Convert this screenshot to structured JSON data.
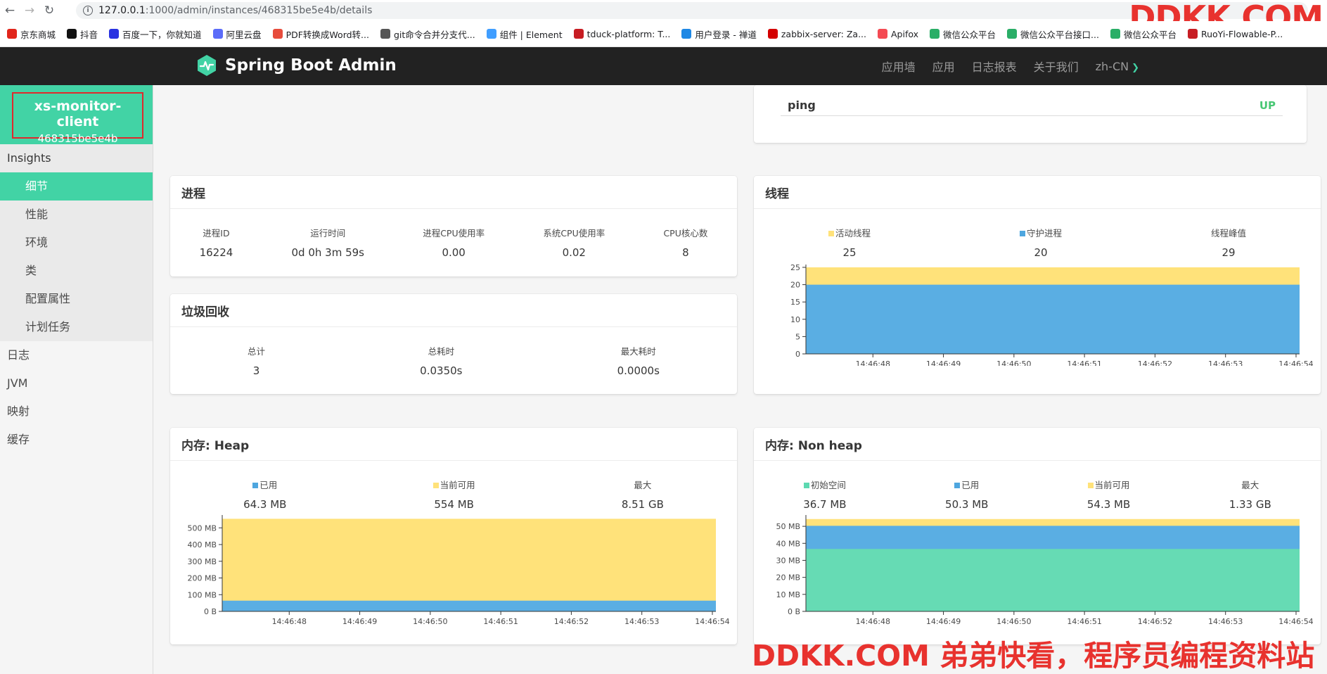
{
  "browser": {
    "url_host": "127.0.0.1",
    "url_path": ":1000/admin/instances/468315be5e4b/details",
    "bookmarks": [
      {
        "label": "京东商城",
        "icon": "jd-icon",
        "color": "#e1251b"
      },
      {
        "label": "抖音",
        "icon": "tiktok-icon",
        "color": "#111111"
      },
      {
        "label": "百度一下，你就知道",
        "icon": "baidu-icon",
        "color": "#2932e1"
      },
      {
        "label": "阿里云盘",
        "icon": "aliyun-drive-icon",
        "color": "#5b6cf9"
      },
      {
        "label": "PDF转换成Word转...",
        "icon": "pdf-icon",
        "color": "#e74c3c"
      },
      {
        "label": "git命令合并分支代...",
        "icon": "git-icon",
        "color": "#555555"
      },
      {
        "label": "组件 | Element",
        "icon": "element-icon",
        "color": "#409eff"
      },
      {
        "label": "tduck-platform: T...",
        "icon": "gitee-icon",
        "color": "#c71d23"
      },
      {
        "label": "用户登录 - 禅道",
        "icon": "zentao-icon",
        "color": "#1e88e5"
      },
      {
        "label": "zabbix-server: Za...",
        "icon": "zabbix-icon",
        "color": "#d40000"
      },
      {
        "label": "Apifox",
        "icon": "apifox-icon",
        "color": "#f44a53"
      },
      {
        "label": "微信公众平台",
        "icon": "wechat-icon",
        "color": "#2aae67"
      },
      {
        "label": "微信公众平台接口...",
        "icon": "wechat-icon",
        "color": "#2aae67"
      },
      {
        "label": "微信公众平台",
        "icon": "wechat-icon",
        "color": "#2aae67"
      },
      {
        "label": "RuoYi-Flowable-P...",
        "icon": "gitee-icon",
        "color": "#c71d23"
      }
    ]
  },
  "watermark": {
    "top": "DDKK.COM",
    "bottom": "DDKK.COM 弟弟快看，程序员编程资料站"
  },
  "app": {
    "brand": "Spring Boot Admin",
    "nav": [
      "应用墙",
      "应用",
      "日志报表",
      "关于我们",
      "zh-CN"
    ],
    "accent": "#42d3a5"
  },
  "sidebar": {
    "app_name": "xs-monitor-client",
    "instance_id": "468315be5e4b",
    "section": "Insights",
    "items": [
      "细节",
      "性能",
      "环境",
      "类",
      "配置属性",
      "计划任务"
    ],
    "active_item": "细节",
    "top_items": [
      "日志",
      "JVM",
      "映射",
      "缓存"
    ]
  },
  "health": {
    "name": "ping",
    "status": "UP"
  },
  "process": {
    "title": "进程",
    "stats": [
      {
        "label": "进程ID",
        "value": "16224"
      },
      {
        "label": "运行时间",
        "value": "0d 0h 3m 59s"
      },
      {
        "label": "进程CPU使用率",
        "value": "0.00"
      },
      {
        "label": "系统CPU使用率",
        "value": "0.02"
      },
      {
        "label": "CPU核心数",
        "value": "8"
      }
    ]
  },
  "gc": {
    "title": "垃圾回收",
    "stats": [
      {
        "label": "总计",
        "value": "3"
      },
      {
        "label": "总耗时",
        "value": "0.0350s"
      },
      {
        "label": "最大耗时",
        "value": "0.0000s"
      }
    ]
  },
  "threads": {
    "title": "线程",
    "stats": [
      {
        "label": "活动线程",
        "value": "25",
        "color": "#ffe27a"
      },
      {
        "label": "守护进程",
        "value": "20",
        "color": "#4ea6df"
      },
      {
        "label": "线程峰值",
        "value": "29",
        "color": null
      }
    ]
  },
  "heap": {
    "title": "内存: Heap",
    "stats": [
      {
        "label": "已用",
        "value": "64.3 MB",
        "color": "#4ea6df"
      },
      {
        "label": "当前可用",
        "value": "554 MB",
        "color": "#ffe27a"
      },
      {
        "label": "最大",
        "value": "8.51 GB",
        "color": null
      }
    ]
  },
  "nonheap": {
    "title": "内存: Non heap",
    "stats": [
      {
        "label": "初始空间",
        "value": "36.7 MB",
        "color": "#5dd9b1"
      },
      {
        "label": "已用",
        "value": "50.3 MB",
        "color": "#4ea6df"
      },
      {
        "label": "当前可用",
        "value": "54.3 MB",
        "color": "#ffe27a"
      },
      {
        "label": "最大",
        "value": "1.33 GB",
        "color": null
      }
    ]
  },
  "chart_data": [
    {
      "id": "threads",
      "type": "area",
      "x": [
        "14:46:48",
        "14:46:49",
        "14:46:50",
        "14:46:51",
        "14:46:52",
        "14:46:53",
        "14:46:54"
      ],
      "y_ticks": [
        "0",
        "5",
        "10",
        "15",
        "20",
        "25"
      ],
      "ylim": [
        0,
        25
      ],
      "series": [
        {
          "name": "守护进程",
          "color": "#5aaee3",
          "values": [
            20,
            20,
            20,
            20,
            20,
            20,
            20,
            20
          ]
        },
        {
          "name": "活动线程",
          "color": "#ffe27a",
          "values": [
            25,
            25,
            25,
            25,
            25,
            25,
            25,
            25
          ]
        }
      ]
    },
    {
      "id": "heap",
      "type": "area",
      "x": [
        "14:46:48",
        "14:46:49",
        "14:46:50",
        "14:46:51",
        "14:46:52",
        "14:46:53",
        "14:46:54"
      ],
      "y_ticks": [
        "0 B",
        "100 MB",
        "200 MB",
        "300 MB",
        "400 MB",
        "500 MB"
      ],
      "ylim": [
        0,
        560
      ],
      "series": [
        {
          "name": "已用",
          "color": "#5aaee3",
          "values": [
            64.3,
            64.3,
            64.3,
            64.3,
            64.3,
            64.3,
            64.3,
            64.3
          ]
        },
        {
          "name": "当前可用",
          "color": "#ffe27a",
          "values": [
            554,
            554,
            554,
            554,
            554,
            554,
            554,
            554
          ]
        }
      ]
    },
    {
      "id": "nonheap",
      "type": "area",
      "x": [
        "14:46:48",
        "14:46:49",
        "14:46:50",
        "14:46:51",
        "14:46:52",
        "14:46:53",
        "14:46:54"
      ],
      "y_ticks": [
        "0 B",
        "10 MB",
        "20 MB",
        "30 MB",
        "40 MB",
        "50 MB"
      ],
      "ylim": [
        0,
        55
      ],
      "series": [
        {
          "name": "初始空间",
          "color": "#66dbb4",
          "values": [
            36.7,
            36.7,
            36.7,
            36.7,
            36.7,
            36.7,
            36.7,
            36.7
          ]
        },
        {
          "name": "已用",
          "color": "#5aaee3",
          "values": [
            50.3,
            50.3,
            50.3,
            50.3,
            50.3,
            50.3,
            50.3,
            50.3
          ]
        },
        {
          "name": "当前可用",
          "color": "#ffe27a",
          "values": [
            54.3,
            54.3,
            54.3,
            54.3,
            54.3,
            54.3,
            54.3,
            54.3
          ]
        }
      ]
    }
  ]
}
